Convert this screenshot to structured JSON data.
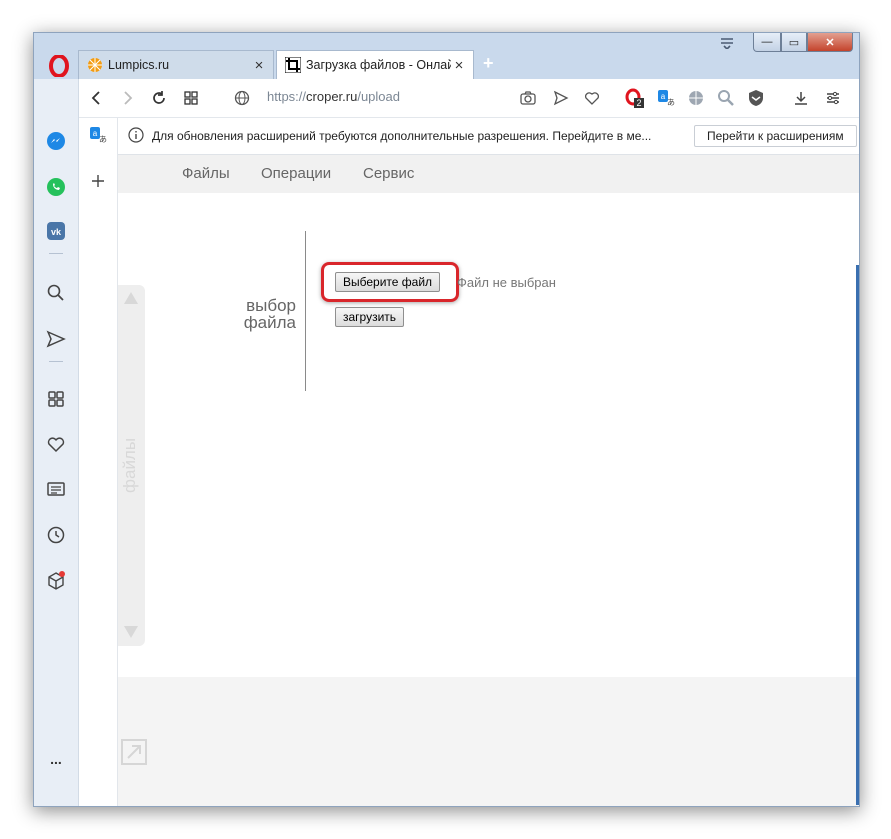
{
  "window": {
    "tabs": [
      {
        "title": "Lumpics.ru",
        "close": "×"
      },
      {
        "title": "Загрузка файлов - Онлайн",
        "close": "×"
      }
    ],
    "new_tab": "+",
    "controls": {
      "minimize": "—",
      "maximize": "▭",
      "close": "✕"
    }
  },
  "toolbar": {
    "url_prefix": "https://",
    "url_host": "croper.ru",
    "url_path": "/upload",
    "badge_count": "2"
  },
  "infobar": {
    "message": "Для обновления расширений требуются дополнительные разрешения. Перейдите в ме...",
    "button": "Перейти к расширениям",
    "close": "×"
  },
  "site": {
    "nav": [
      "Файлы",
      "Операции",
      "Сервис"
    ],
    "side_tab": "файлы",
    "label_line1": "выбор",
    "label_line2": "файла",
    "choose_button": "Выберите файл",
    "no_file": "Файл не выбран",
    "upload_button": "загрузить"
  },
  "sidebar": {
    "more": "..."
  },
  "colors": {
    "accent": "#d9262b",
    "opera_red": "#e0141e",
    "messenger": "#1e88e5",
    "whatsapp": "#25c15c",
    "vk": "#4a76a8"
  }
}
